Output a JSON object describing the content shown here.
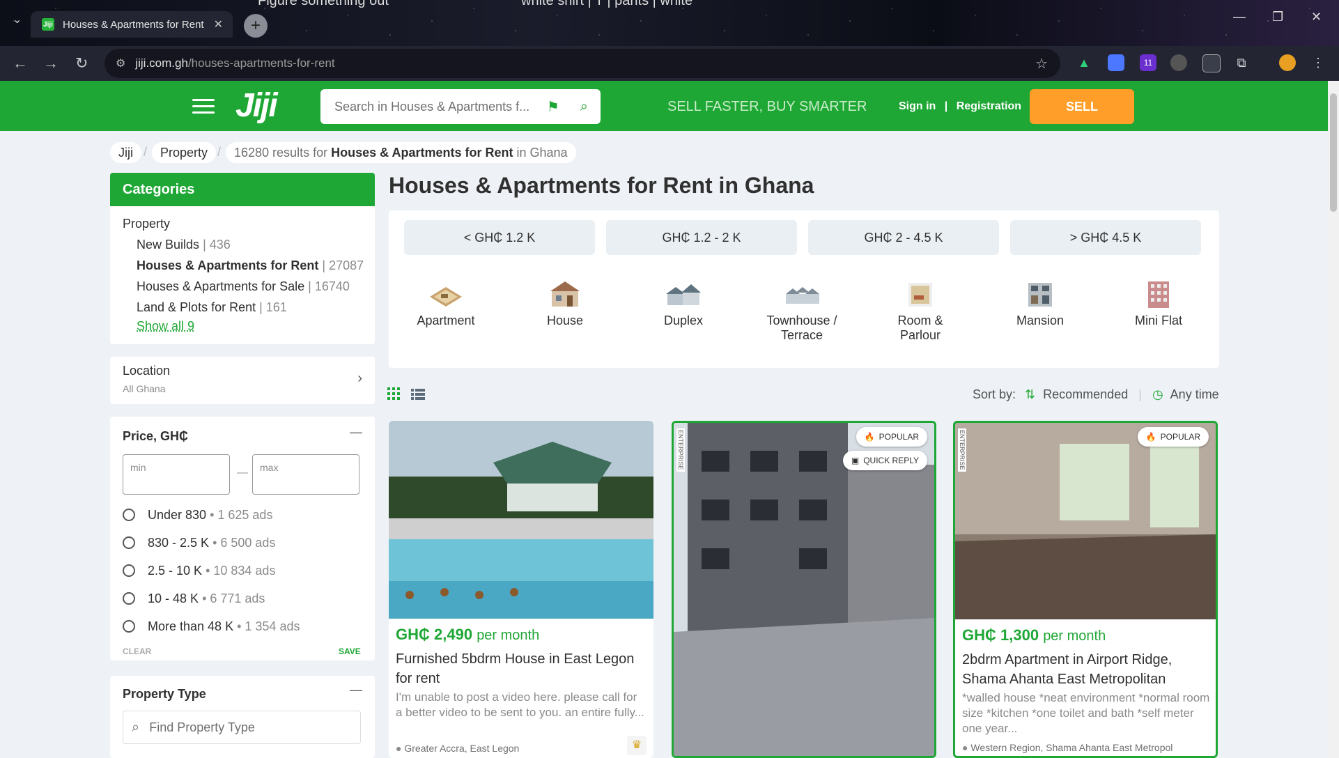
{
  "browser": {
    "tab_title": "Houses & Apartments for Rent",
    "tab_favicon": "Jiji",
    "bg_tab_1": "Figure something out",
    "bg_tab_2": "white shirt | T | pants | white",
    "url_domain": "jiji.com.gh",
    "url_path": "/houses-apartments-for-rent",
    "ext_badge": "11"
  },
  "header": {
    "logo": "Jiji",
    "search_placeholder": "Search in Houses & Apartments f...",
    "slogan": "SELL FASTER, BUY SMARTER",
    "sign_in": "Sign in",
    "separator": "|",
    "registration": "Registration",
    "sell": "SELL",
    "brand_color": "#1fa735",
    "sell_color": "#ff9f2a"
  },
  "breadcrumb": {
    "home": "Jiji",
    "property": "Property",
    "results_count": "16280 results for",
    "results_bold": "Houses & Apartments for Rent",
    "results_tail": "in Ghana"
  },
  "categories": {
    "title": "Categories",
    "parent": "Property",
    "items": [
      {
        "label": "New Builds",
        "count": "| 436"
      },
      {
        "label": "Houses & Apartments for Rent",
        "count": "| 27087"
      },
      {
        "label": "Houses & Apartments for Sale",
        "count": "| 16740"
      },
      {
        "label": "Land & Plots for Rent",
        "count": "| 161"
      }
    ],
    "show_all": "Show all 9"
  },
  "location": {
    "title": "Location",
    "value": "All Ghana"
  },
  "price_filter": {
    "title": "Price, GH₵",
    "min_placeholder": "min",
    "max_placeholder": "max",
    "dash": "—",
    "options": [
      {
        "label": "Under 830",
        "ads": "• 1 625 ads"
      },
      {
        "label": "830 - 2.5 K",
        "ads": "• 6 500 ads"
      },
      {
        "label": "2.5 - 10 K",
        "ads": "• 10 834 ads"
      },
      {
        "label": "10 - 48 K",
        "ads": "• 6 771 ads"
      },
      {
        "label": "More than 48 K",
        "ads": "• 1 354 ads"
      }
    ],
    "clear": "CLEAR",
    "save": "SAVE"
  },
  "property_type": {
    "title": "Property Type",
    "search_placeholder": "Find Property Type"
  },
  "main": {
    "title": "Houses & Apartments for Rent in Ghana",
    "price_chips": [
      "< GH₵ 1.2 K",
      "GH₵ 1.2 - 2 K",
      "GH₵ 2 - 4.5 K",
      "> GH₵ 4.5 K"
    ],
    "types": [
      {
        "line1": "Apartment",
        "line2": ""
      },
      {
        "line1": "House",
        "line2": ""
      },
      {
        "line1": "Duplex",
        "line2": ""
      },
      {
        "line1": "Townhouse /",
        "line2": "Terrace"
      },
      {
        "line1": "Room &",
        "line2": "Parlour"
      },
      {
        "line1": "Mansion",
        "line2": ""
      },
      {
        "line1": "Mini Flat",
        "line2": ""
      }
    ],
    "sort_label": "Sort by:",
    "sort_value": "Recommended",
    "time_value": "Any time"
  },
  "listings": [
    {
      "price": "GH₵ 2,490",
      "per": "per month",
      "title": "Furnished 5bdrm House in East Legon for rent",
      "desc": "I'm unable to post a video here. please call for a better video to be sent to you. an entire fully...",
      "location": "Greater Accra, East Legon"
    },
    {
      "enterprise": "ENTERPRISE",
      "badge_popular": "POPULAR",
      "badge_quick": "QUICK REPLY"
    },
    {
      "enterprise": "ENTERPRISE",
      "badge_popular": "POPULAR",
      "price": "GH₵ 1,300",
      "per": "per month",
      "title": "2bdrm Apartment in Airport Ridge, Shama Ahanta East Metropolitan",
      "desc": "*walled house *neat environment *normal room size *kitchen *one toilet and bath *self meter one year...",
      "location": "Western Region, Shama Ahanta East Metropol"
    }
  ]
}
